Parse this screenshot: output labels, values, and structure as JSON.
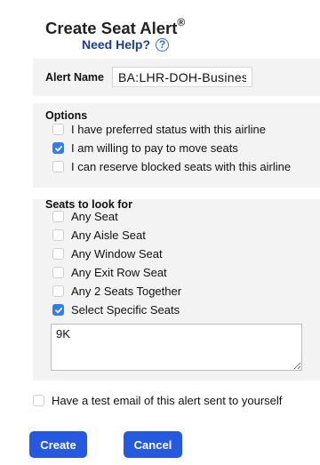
{
  "header": {
    "title": "Create Seat Alert",
    "title_mark": "®",
    "help_label": "Need Help?",
    "help_icon": "?"
  },
  "alert_name": {
    "label": "Alert Name",
    "value": "BA:LHR-DOH-Business"
  },
  "options": {
    "label": "Options",
    "items": [
      {
        "label": "I have preferred status with this airline",
        "checked": false
      },
      {
        "label": "I am willing to pay to move seats",
        "checked": true
      },
      {
        "label": "I can reserve blocked seats with this airline",
        "checked": false
      }
    ]
  },
  "seats": {
    "label": "Seats to look for",
    "items": [
      {
        "label": "Any Seat",
        "checked": false
      },
      {
        "label": "Any Aisle Seat",
        "checked": false
      },
      {
        "label": "Any Window Seat",
        "checked": false
      },
      {
        "label": "Any Exit Row Seat",
        "checked": false
      },
      {
        "label": "Any 2 Seats Together",
        "checked": false
      },
      {
        "label": "Select Specific Seats",
        "checked": true
      }
    ],
    "specific_seats_value": "9K"
  },
  "test_email": {
    "label": "Have a test email of this alert sent to yourself",
    "checked": false
  },
  "buttons": {
    "create_label": "Create",
    "cancel_label": "Cancel"
  },
  "colors": {
    "accent": "#2459e0",
    "checkbox_checked": "#2f7cf6",
    "help_text": "#1a3c9e",
    "panel_bg": "#f3f3f3"
  }
}
